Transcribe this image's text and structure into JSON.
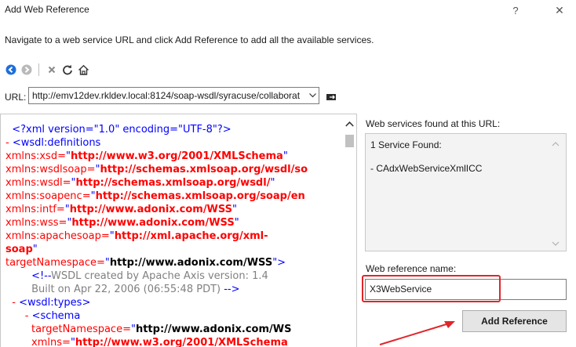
{
  "window": {
    "title": "Add Web Reference",
    "help_glyph": "?",
    "close_glyph": "✕"
  },
  "instruction": "Navigate to a web service URL and click Add Reference to add all the available services.",
  "toolbar": {
    "icons": [
      "back-icon",
      "forward-icon",
      "stop-icon",
      "refresh-icon",
      "home-icon"
    ]
  },
  "url_bar": {
    "label": "URL:",
    "value": "http://emv12dev.rkldev.local:8124/soap-wsdl/syracuse/collaborat"
  },
  "xml_view": {
    "lines": [
      [
        {
          "t": "  ",
          "c": "c-blue"
        },
        {
          "t": "<?xml version=\"1.0\" encoding=\"UTF-8\"?>",
          "c": "c-blue"
        }
      ],
      [
        {
          "t": "- ",
          "c": "c-minus"
        },
        {
          "t": "<wsdl:definitions",
          "c": "c-blue"
        }
      ],
      [
        {
          "t": "xmlns:xsd=",
          "c": "c-red"
        },
        {
          "t": "\"",
          "c": "c-blue"
        },
        {
          "t": "http://www.w3.org/2001/XMLSchema",
          "c": "c-red b"
        },
        {
          "t": "\"",
          "c": "c-blue"
        }
      ],
      [
        {
          "t": "xmlns:wsdlsoap=",
          "c": "c-red"
        },
        {
          "t": "\"",
          "c": "c-blue"
        },
        {
          "t": "http://schemas.xmlsoap.org/wsdl/so",
          "c": "c-red b"
        }
      ],
      [
        {
          "t": "xmlns:wsdl=",
          "c": "c-red"
        },
        {
          "t": "\"",
          "c": "c-blue"
        },
        {
          "t": "http://schemas.xmlsoap.org/wsdl/",
          "c": "c-red b"
        },
        {
          "t": "\"",
          "c": "c-blue"
        }
      ],
      [
        {
          "t": "xmlns:soapenc=",
          "c": "c-red"
        },
        {
          "t": "\"",
          "c": "c-blue"
        },
        {
          "t": "http://schemas.xmlsoap.org/soap/en",
          "c": "c-red b"
        }
      ],
      [
        {
          "t": "xmlns:intf=",
          "c": "c-red"
        },
        {
          "t": "\"",
          "c": "c-blue"
        },
        {
          "t": "http://www.adonix.com/WSS",
          "c": "c-red b"
        },
        {
          "t": "\"",
          "c": "c-blue"
        }
      ],
      [
        {
          "t": "xmlns:wss=",
          "c": "c-red"
        },
        {
          "t": "\"",
          "c": "c-blue"
        },
        {
          "t": "http://www.adonix.com/WSS",
          "c": "c-red b"
        },
        {
          "t": "\"",
          "c": "c-blue"
        }
      ],
      [
        {
          "t": "xmlns:apachesoap=",
          "c": "c-red"
        },
        {
          "t": "\"",
          "c": "c-blue"
        },
        {
          "t": "http://xml.apache.org/xml-",
          "c": "c-red b"
        }
      ],
      [
        {
          "t": "soap",
          "c": "c-red b"
        },
        {
          "t": "\"",
          "c": "c-blue"
        }
      ],
      [
        {
          "t": "targetNamespace=",
          "c": "c-red"
        },
        {
          "t": "\"",
          "c": "c-blue"
        },
        {
          "t": "http://www.adonix.com/WSS",
          "c": "c-black"
        },
        {
          "t": "\">",
          "c": "c-blue"
        }
      ],
      [
        {
          "t": "        ",
          "c": "c-blue"
        },
        {
          "t": "<!--",
          "c": "c-blue"
        },
        {
          "t": "WSDL created by Apache Axis version: 1.4",
          "c": "c-grey"
        }
      ],
      [
        {
          "t": "        ",
          "c": "c-grey"
        },
        {
          "t": "Built on Apr 22, 2006 (06:55:48 PDT) ",
          "c": "c-grey"
        },
        {
          "t": "-->",
          "c": "c-blue"
        }
      ],
      [
        {
          "t": "  - ",
          "c": "c-minus"
        },
        {
          "t": "<wsdl:types>",
          "c": "c-blue"
        }
      ],
      [
        {
          "t": "      - ",
          "c": "c-minus"
        },
        {
          "t": "<schema",
          "c": "c-blue"
        }
      ],
      [
        {
          "t": "        targetNamespace=",
          "c": "c-red"
        },
        {
          "t": "\"",
          "c": "c-blue"
        },
        {
          "t": "http://www.adonix.com/WS",
          "c": "c-black"
        }
      ],
      [
        {
          "t": "        xmlns=",
          "c": "c-red"
        },
        {
          "t": "\"",
          "c": "c-blue"
        },
        {
          "t": "http://www.w3.org/2001/XMLSchema",
          "c": "c-red b"
        }
      ]
    ]
  },
  "right_panel": {
    "found_label": "Web services found at this URL:",
    "found_count": "1 Service Found:",
    "services": [
      "- CAdxWebServiceXmlICC"
    ],
    "name_label": "Web reference name:",
    "name_value": "X3WebService",
    "add_button": "Add Reference"
  },
  "colors": {
    "highlight": "#e0262b",
    "xml_tag": "#0000ff",
    "xml_attr": "#ff0000"
  }
}
